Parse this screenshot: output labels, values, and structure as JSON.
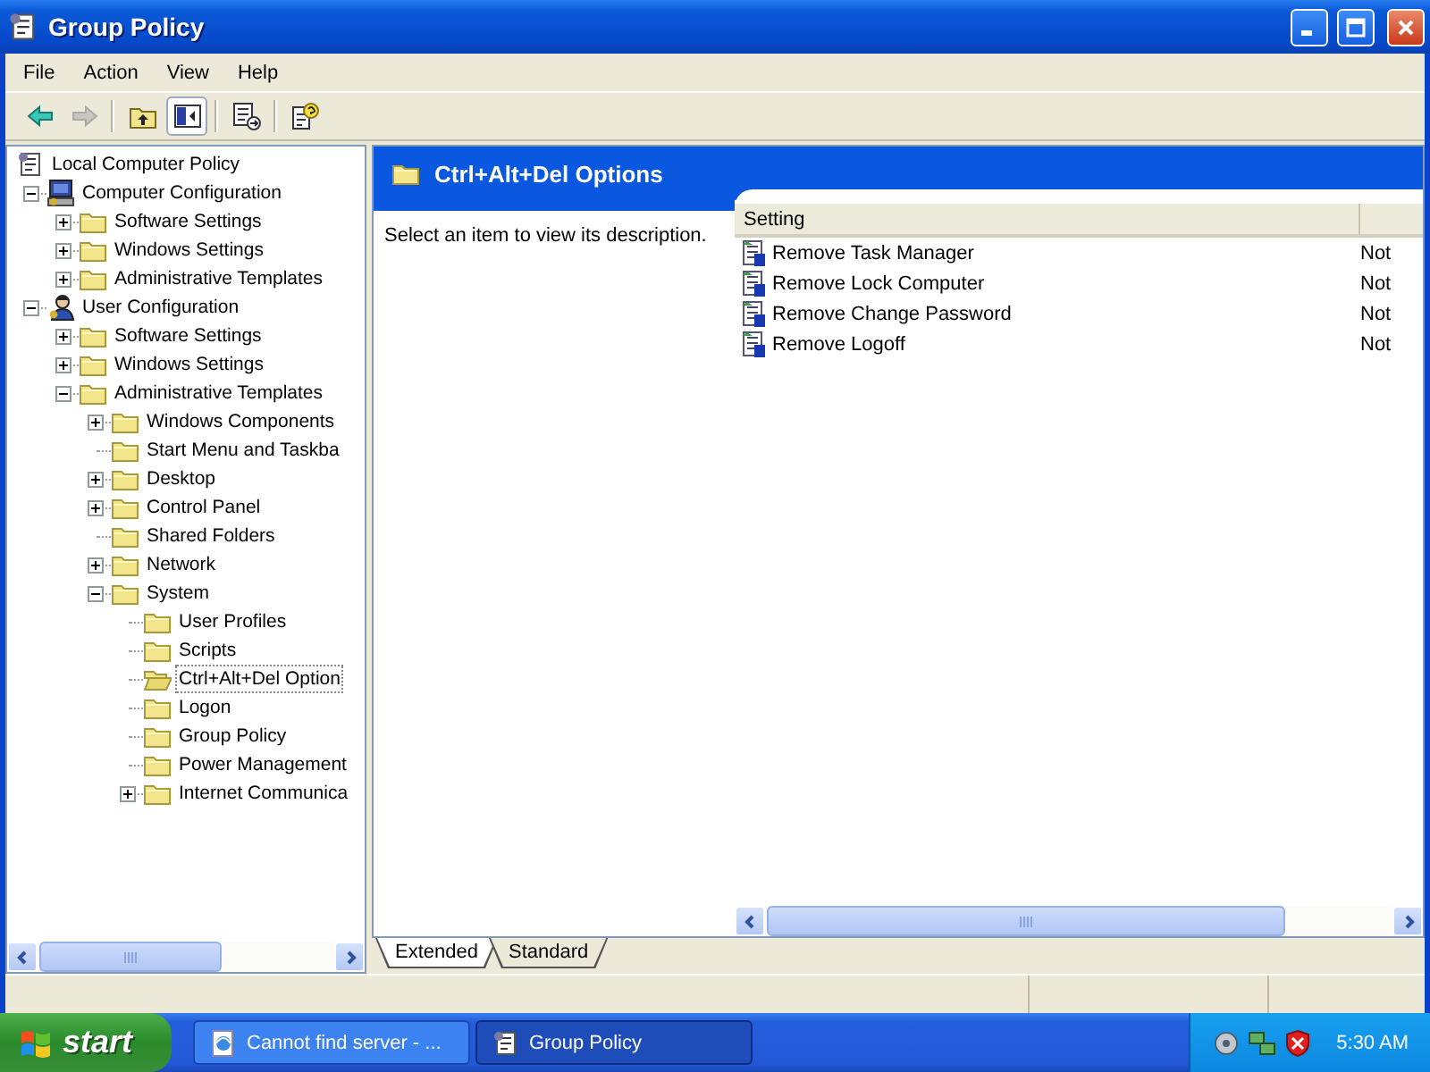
{
  "window": {
    "title": "Group Policy"
  },
  "menu": [
    "File",
    "Action",
    "View",
    "Help"
  ],
  "toolbar": [
    [
      {
        "kind": "back",
        "disabled": false,
        "pressed": false
      },
      {
        "kind": "forward",
        "disabled": true,
        "pressed": false
      }
    ],
    [
      {
        "kind": "up",
        "disabled": false,
        "pressed": false
      },
      {
        "kind": "tree",
        "disabled": false,
        "pressed": true
      }
    ],
    [
      {
        "kind": "export",
        "disabled": false,
        "pressed": false
      }
    ],
    [
      {
        "kind": "help",
        "disabled": false,
        "pressed": false
      }
    ]
  ],
  "tree": [
    {
      "label": "Local Computer Policy",
      "kind": "policy",
      "selected": false,
      "children": [
        {
          "label": "Computer Configuration",
          "kind": "computer",
          "expanded": true,
          "selected": false,
          "children": [
            {
              "label": "Software Settings",
              "kind": "folder",
              "expanded": false,
              "selected": false
            },
            {
              "label": "Windows Settings",
              "kind": "folder",
              "expanded": false,
              "selected": false
            },
            {
              "label": "Administrative Templates",
              "kind": "folder",
              "expanded": false,
              "selected": false
            }
          ]
        },
        {
          "label": "User Configuration",
          "kind": "user",
          "expanded": true,
          "selected": false,
          "children": [
            {
              "label": "Software Settings",
              "kind": "folder",
              "expanded": false,
              "selected": false
            },
            {
              "label": "Windows Settings",
              "kind": "folder",
              "expanded": false,
              "selected": false
            },
            {
              "label": "Administrative Templates",
              "kind": "folder",
              "expanded": true,
              "selected": false,
              "children": [
                {
                  "label": "Windows Components",
                  "kind": "folder",
                  "expanded": false,
                  "selected": false
                },
                {
                  "label": "Start Menu and Taskba",
                  "kind": "folder",
                  "selected": false
                },
                {
                  "label": "Desktop",
                  "kind": "folder",
                  "expanded": false,
                  "selected": false
                },
                {
                  "label": "Control Panel",
                  "kind": "folder",
                  "expanded": false,
                  "selected": false
                },
                {
                  "label": "Shared Folders",
                  "kind": "folder",
                  "selected": false
                },
                {
                  "label": "Network",
                  "kind": "folder",
                  "expanded": false,
                  "selected": false
                },
                {
                  "label": "System",
                  "kind": "folder",
                  "expanded": true,
                  "selected": false,
                  "children": [
                    {
                      "label": "User Profiles",
                      "kind": "folder",
                      "selected": false
                    },
                    {
                      "label": "Scripts",
                      "kind": "folder",
                      "selected": false
                    },
                    {
                      "label": "Ctrl+Alt+Del Option",
                      "kind": "folder",
                      "selected": true
                    },
                    {
                      "label": "Logon",
                      "kind": "folder",
                      "selected": false
                    },
                    {
                      "label": "Group Policy",
                      "kind": "folder",
                      "selected": false
                    },
                    {
                      "label": "Power Management",
                      "kind": "folder",
                      "selected": false
                    },
                    {
                      "label": "Internet Communica",
                      "kind": "folder",
                      "expanded": false,
                      "selected": false
                    }
                  ]
                }
              ]
            }
          ]
        }
      ]
    }
  ],
  "details": {
    "title": "Ctrl+Alt+Del Options",
    "description": "Select an item to view its description."
  },
  "table": {
    "columns": [
      "Setting"
    ],
    "rows": [
      {
        "setting": "Remove Task Manager",
        "column_2": "Not"
      },
      {
        "setting": "Remove Lock Computer",
        "column_2": "Not"
      },
      {
        "setting": "Remove Change Password",
        "column_2": "Not"
      },
      {
        "setting": "Remove Logoff",
        "column_2": "Not"
      }
    ]
  },
  "view_tabs": [
    {
      "label": "Extended",
      "selected": true
    },
    {
      "label": "Standard",
      "selected": false
    }
  ],
  "taskbar": {
    "start": "start",
    "tasks": [
      {
        "label": "Cannot find server - ...",
        "kind": "browser",
        "selected": false
      },
      {
        "label": "Group Policy",
        "kind": "policy",
        "selected": true
      }
    ],
    "clock": "5:30 AM"
  }
}
